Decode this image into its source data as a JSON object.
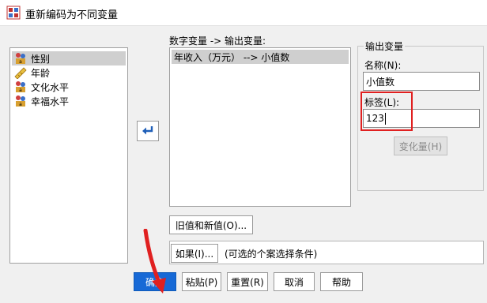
{
  "window": {
    "title": "重新编码为不同变量"
  },
  "variables": [
    {
      "label": "性别",
      "icon": "nominal-scale-icon",
      "selected": true
    },
    {
      "label": "年龄",
      "icon": "scale-ruler-icon",
      "selected": false
    },
    {
      "label": "文化水平",
      "icon": "nominal-scale-icon",
      "selected": false
    },
    {
      "label": "幸福水平",
      "icon": "nominal-scale-icon",
      "selected": false
    }
  ],
  "mapping": {
    "header": "数字变量 -> 输出变量:",
    "items": [
      "年收入（万元） --> 小值数"
    ]
  },
  "output": {
    "group_title": "输出变量",
    "name_label": "名称(N):",
    "name_value": "小值数",
    "label_label": "标签(L):",
    "label_value": "123",
    "change_button": "变化量(H)"
  },
  "buttons": {
    "old_new": "旧值和新值(O)...",
    "if": "如果(I)...",
    "if_caption": "(可选的个案选择条件)",
    "ok": "确定",
    "paste": "粘贴(P)",
    "reset": "重置(R)",
    "cancel": "取消",
    "help": "帮助"
  }
}
